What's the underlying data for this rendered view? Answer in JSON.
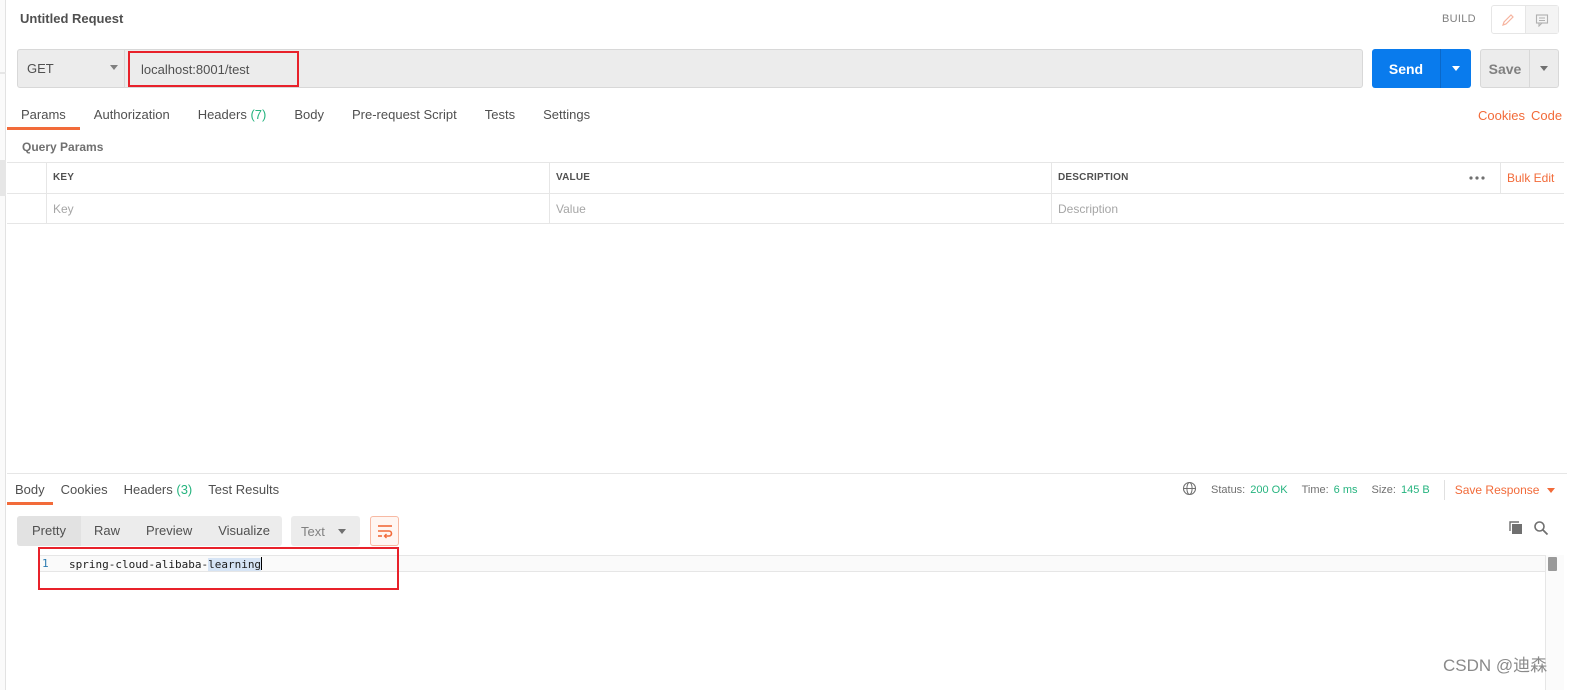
{
  "header": {
    "title": "Untitled Request",
    "mode": "BUILD"
  },
  "request": {
    "method": "GET",
    "url": "localhost:8001/test",
    "send_label": "Send",
    "save_label": "Save"
  },
  "req_tabs": [
    {
      "label": "Params",
      "active": true
    },
    {
      "label": "Authorization"
    },
    {
      "label": "Headers",
      "count": "(7)"
    },
    {
      "label": "Body"
    },
    {
      "label": "Pre-request Script"
    },
    {
      "label": "Tests"
    },
    {
      "label": "Settings"
    }
  ],
  "links": {
    "cookies": "Cookies",
    "code": "Code"
  },
  "params": {
    "section_label": "Query Params",
    "headers": [
      "KEY",
      "VALUE",
      "DESCRIPTION"
    ],
    "placeholders": [
      "Key",
      "Value",
      "Description"
    ],
    "bulk_edit": "Bulk Edit"
  },
  "response": {
    "tabs": [
      {
        "label": "Body",
        "active": true
      },
      {
        "label": "Cookies"
      },
      {
        "label": "Headers",
        "count": "(3)"
      },
      {
        "label": "Test Results"
      }
    ],
    "status_label": "Status:",
    "status_value": "200 OK",
    "time_label": "Time:",
    "time_value": "6 ms",
    "size_label": "Size:",
    "size_value": "145 B",
    "save_response": "Save Response",
    "view_tabs": [
      "Pretty",
      "Raw",
      "Preview",
      "Visualize"
    ],
    "format": "Text",
    "line_number": "1",
    "body_text_main": "spring-cloud-alibaba-",
    "body_text_selected": "learning"
  },
  "watermark": "CSDN @迪森",
  "colors": {
    "accent": "#f26b3a",
    "send": "#097bed",
    "ok": "#26b47f",
    "annotation": "#e8212a"
  }
}
